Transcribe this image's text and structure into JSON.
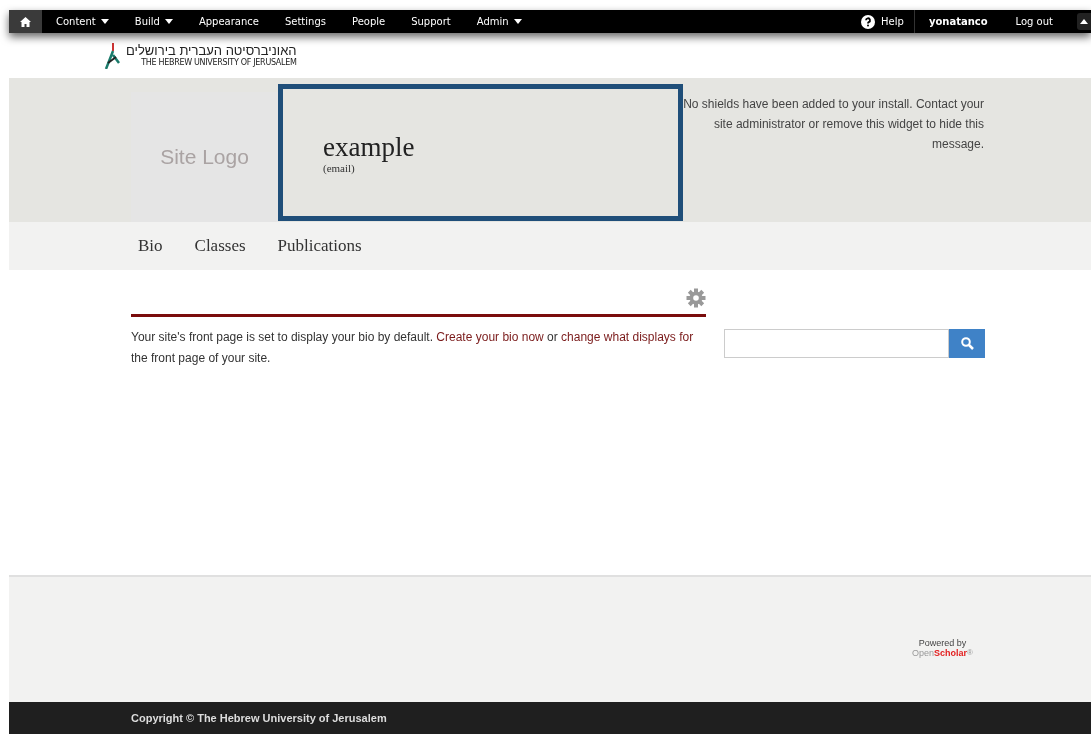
{
  "toolbar": {
    "menu": [
      {
        "label": "Content",
        "has_menu": true
      },
      {
        "label": "Build",
        "has_menu": true
      },
      {
        "label": "Appearance",
        "has_menu": false
      },
      {
        "label": "Settings",
        "has_menu": false
      },
      {
        "label": "People",
        "has_menu": false
      },
      {
        "label": "Support",
        "has_menu": false
      },
      {
        "label": "Admin",
        "has_menu": true
      }
    ],
    "help": "Help",
    "user": "yonatanco",
    "logout": "Log out"
  },
  "university": {
    "hebrew_name": "האוניברסיטה העברית בירושלים",
    "english_name": "THE HEBREW UNIVERSITY OF JERUSALEM"
  },
  "header": {
    "logo_placeholder": "Site Logo",
    "site_title": "example",
    "site_subtitle": "(email)",
    "shields_message": "No shields have been added to your install. Contact your site administrator or remove this widget to hide this message."
  },
  "nav": [
    "Bio",
    "Classes",
    "Publications"
  ],
  "content": {
    "message": [
      {
        "kind": "text",
        "text": "Your site's front page is set to display your bio by default. "
      },
      {
        "kind": "link",
        "text": "Create your bio now"
      },
      {
        "kind": "text",
        "text": " or "
      },
      {
        "kind": "link",
        "text": "change what displays for"
      },
      {
        "kind": "text",
        "text": " the front page of your site."
      }
    ]
  },
  "footer": {
    "powered_by": "Powered by",
    "brand_open": "Open",
    "brand_scholar": "Scholar",
    "brand_mark": "®",
    "copyright": "Copyright © The Hebrew University of Jerusalem"
  }
}
